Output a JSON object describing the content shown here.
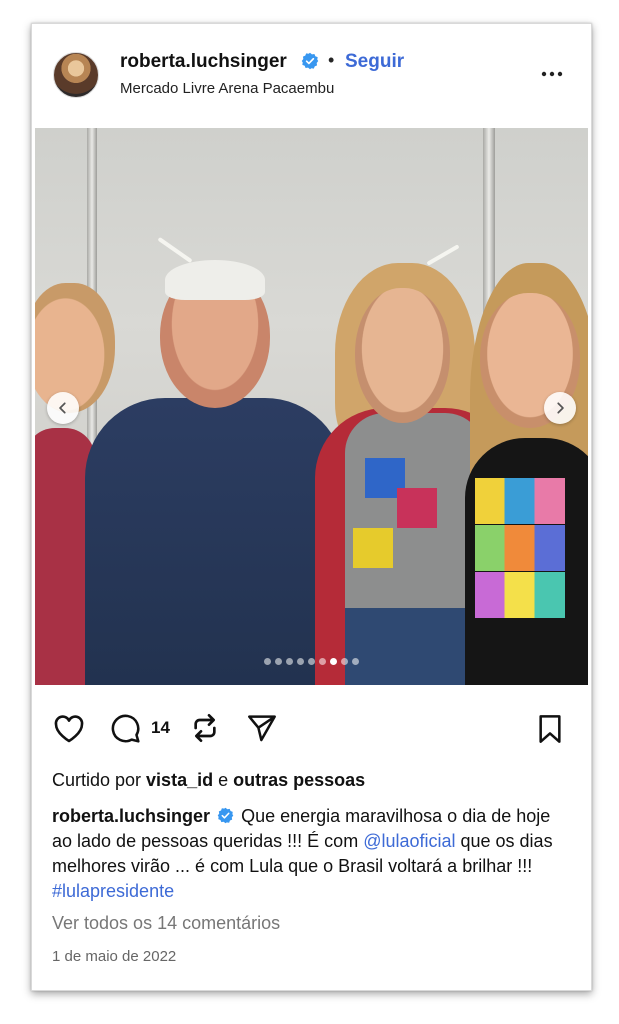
{
  "post": {
    "username": "roberta.luchsinger",
    "separator": "•",
    "follow_label": "Seguir",
    "location": "Mercado Livre Arena Pacaembu",
    "image_count": 9,
    "active_image_index": 6,
    "comment_count": "14",
    "likes": {
      "prefix": "Curtido por ",
      "user": "vista_id",
      "middle": " e ",
      "others": "outras pessoas"
    },
    "caption": {
      "username": "roberta.luchsinger",
      "text1": " Que energia maravilhosa o dia de hoje ao lado de pessoas queridas !!! É com ",
      "mention": "@lulaoficial",
      "text2": " que os dias melhores virão ... é com Lula que o Brasil voltará a brilhar !!! ",
      "hashtag": "#lulapresidente"
    },
    "view_comments": "Ver todos os 14 comentários",
    "date": "1 de maio de 2022"
  },
  "colors": {
    "accent": "#3d6ad6",
    "verified": "#3897f0"
  },
  "icons": {
    "verified": "verified-badge-icon",
    "more": "more-dots-icon",
    "like": "heart-icon",
    "comment": "comment-bubble-icon",
    "repost": "repost-icon",
    "share": "paper-plane-icon",
    "save": "bookmark-icon",
    "prev": "chevron-left-icon",
    "next": "chevron-right-icon"
  }
}
